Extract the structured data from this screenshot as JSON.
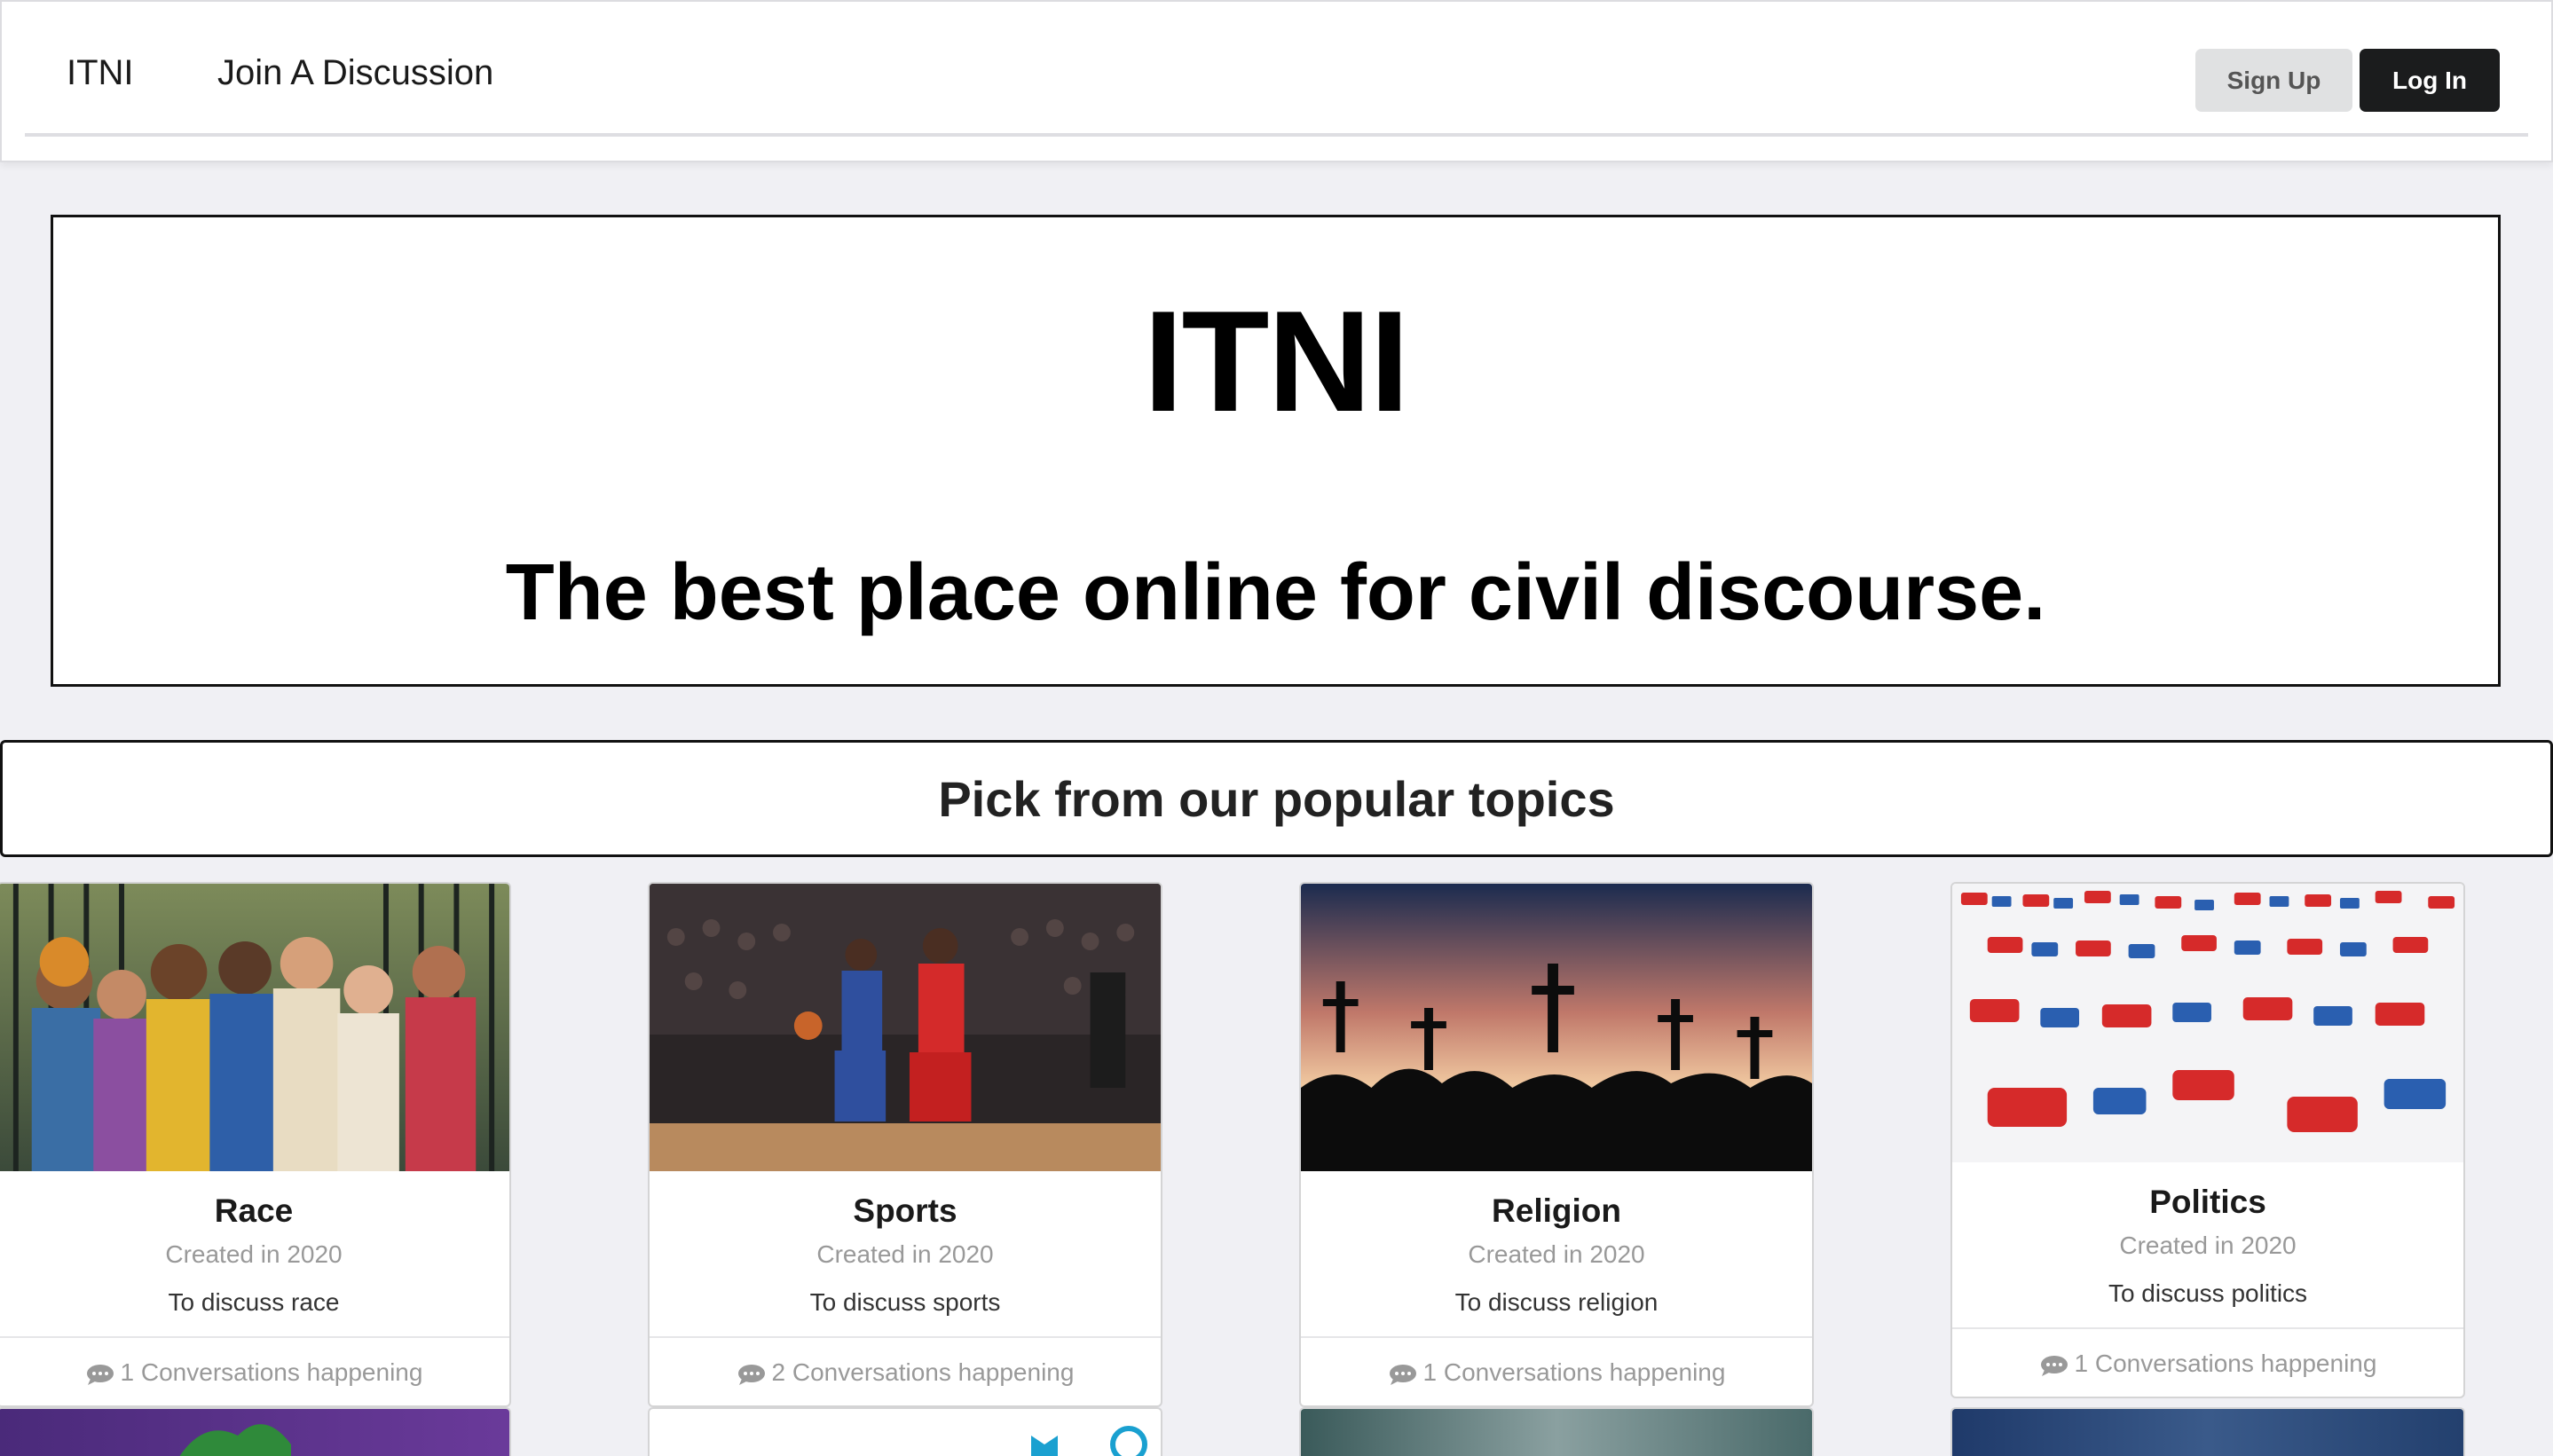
{
  "nav": {
    "brand": "ITNI",
    "join_link": "Join A Discussion",
    "signup_label": "Sign Up",
    "login_label": "Log In"
  },
  "hero": {
    "title": "ITNI",
    "tagline": "The best place online for civil discourse."
  },
  "topics": {
    "heading": "Pick from our popular topics",
    "cards": [
      {
        "title": "Race",
        "meta": "Created in 2020",
        "desc": "To discuss race",
        "footer": "1 Conversations happening",
        "image": "group-of-people-photo"
      },
      {
        "title": "Sports",
        "meta": "Created in 2020",
        "desc": "To discuss sports",
        "footer": "2 Conversations happening",
        "image": "basketball-game-photo"
      },
      {
        "title": "Religion",
        "meta": "Created in 2020",
        "desc": "To discuss religion",
        "footer": "1 Conversations happening",
        "image": "crosses-sunset-photo"
      },
      {
        "title": "Politics",
        "meta": "Created in 2020",
        "desc": "To discuss politics",
        "footer": "1 Conversations happening",
        "image": "elephants-donkeys-photo"
      }
    ]
  },
  "colors": {
    "page_bg": "#f0f0f4",
    "login_bg": "#1b1c1d",
    "signup_bg": "#e0e1e2"
  }
}
